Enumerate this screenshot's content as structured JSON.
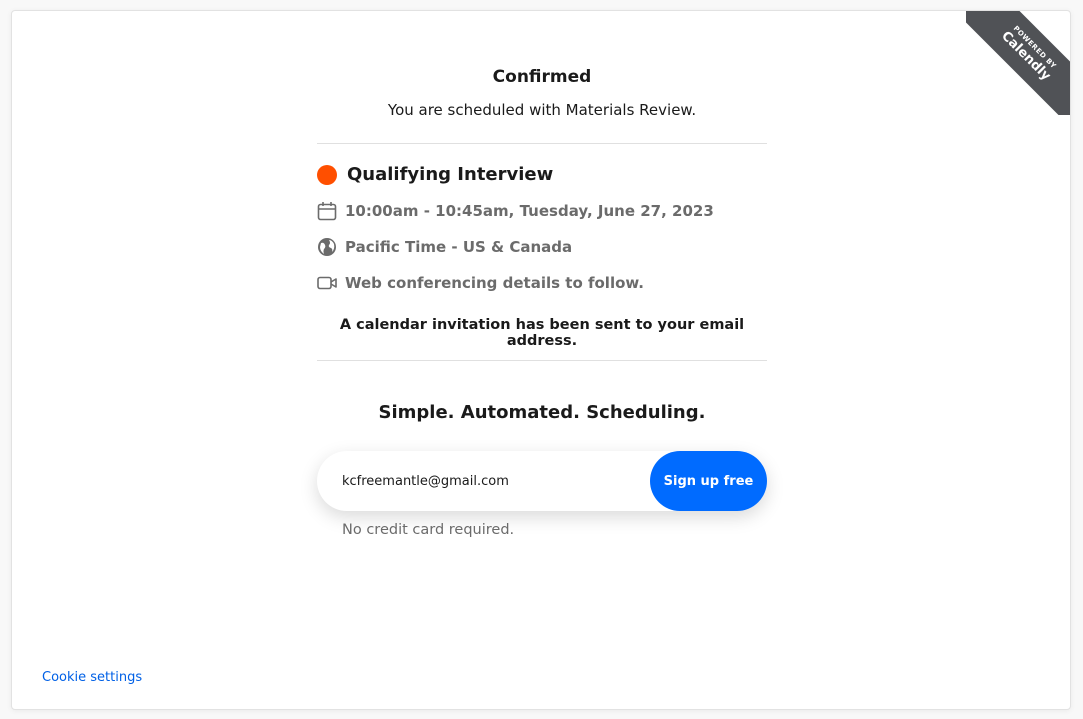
{
  "badge": {
    "powered_by": "POWERED BY",
    "brand": "Calendly"
  },
  "confirmation": {
    "title": "Confirmed",
    "subtitle": "You are scheduled with Materials Review."
  },
  "event": {
    "name": "Qualifying Interview",
    "dot_color": "#ff4f00",
    "time": "10:00am - 10:45am, Tuesday, June 27, 2023",
    "timezone": "Pacific Time - US & Canada",
    "location": "Web conferencing details to follow.",
    "icons": {
      "time": "calendar-icon",
      "timezone": "globe-icon",
      "location": "video-camera-icon"
    }
  },
  "invite_note": "A calendar invitation has been sent to your email address.",
  "promo": {
    "title": "Simple. Automated. Scheduling.",
    "email_value": "kcfreemantle@gmail.com",
    "signup_label": "Sign up free",
    "note": "No credit card required.",
    "accent_color": "#006bff"
  },
  "footer": {
    "cookie_label": "Cookie settings"
  }
}
